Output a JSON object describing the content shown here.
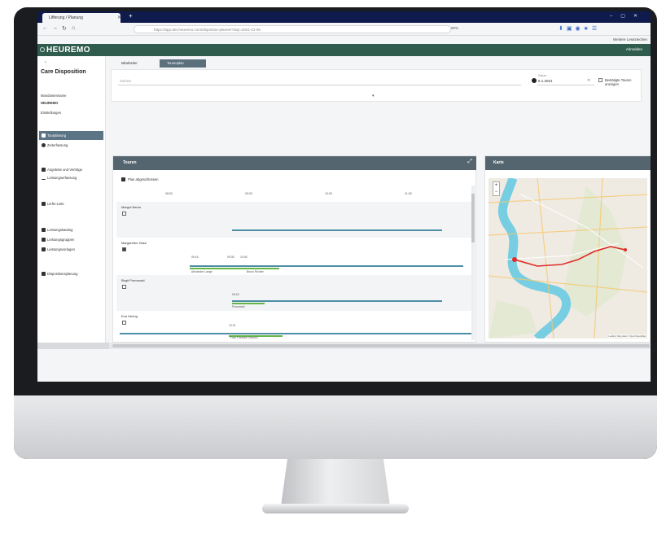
{
  "browser": {
    "tab_title": "Lifferung / Planung",
    "url": "https://app.dev.heuremo.com/dispo/tour-planner?day=2021-01-05",
    "zoom": "90%",
    "bookmark_other": "Weitere Lesezeichen"
  },
  "app": {
    "brand": "HEUREMO",
    "logout": "Abmelden"
  },
  "sidebar": {
    "title": "Care Disposition",
    "org_caption": "Mandantenname",
    "org_name": "HEUREMO",
    "settings": "Einstellungen",
    "items": [
      {
        "label": "Tourplanung"
      },
      {
        "label": "Zeiterfassung"
      },
      {
        "label": "Angebote und Verträge"
      },
      {
        "label": "Leistungserfassung"
      },
      {
        "label": "Liefer-Liste"
      },
      {
        "label": "Leistungskatalog"
      },
      {
        "label": "Leistungsgruppen"
      },
      {
        "label": "Leistungsvorlagen"
      },
      {
        "label": "Dispositionsplanung"
      }
    ]
  },
  "toolbar": {
    "tab_kalender": "Mitarbeiter",
    "tab_tourplan": "Tourenplan"
  },
  "filter": {
    "search_placeholder": "Suchen",
    "date_label": "Datum",
    "date_value": "5.1.2021",
    "show_all_label": "Bestätigte Touren anzeigen"
  },
  "touren": {
    "title": "Touren",
    "plan_label": "Plan abgeschlossen",
    "ticks": [
      "08:00",
      "09:00",
      "10:00",
      "11:00"
    ],
    "rows": [
      {
        "name": "Margot Baron",
        "checked": false
      },
      {
        "name": "Margarethe Hase",
        "checked": true
      },
      {
        "name": "Birgit Pomowski",
        "checked": false
      },
      {
        "name": "Eva Hering",
        "checked": false
      }
    ],
    "marks": [
      "09:15",
      "09:35",
      "10:05",
      "09:15",
      "10:21"
    ],
    "row2_labels": [
      "Alexander Lange",
      "Bruno Richter"
    ],
    "row3_label": "Pomowski",
    "row4_label": "Frau Friedrich Dietrich"
  },
  "karte": {
    "title": "Karte",
    "attribution": "Leaflet | Map data © OpenStreetMap",
    "zoom_in": "+",
    "zoom_out": "−"
  },
  "colors": {
    "appbar": "#2f5c4c",
    "panel_header": "#55656f",
    "active_nav": "#5b7486",
    "route": "#e02b27",
    "river": "#77cde2",
    "bar_blue": "#4e8fa6",
    "bar_green": "#64b54a"
  }
}
